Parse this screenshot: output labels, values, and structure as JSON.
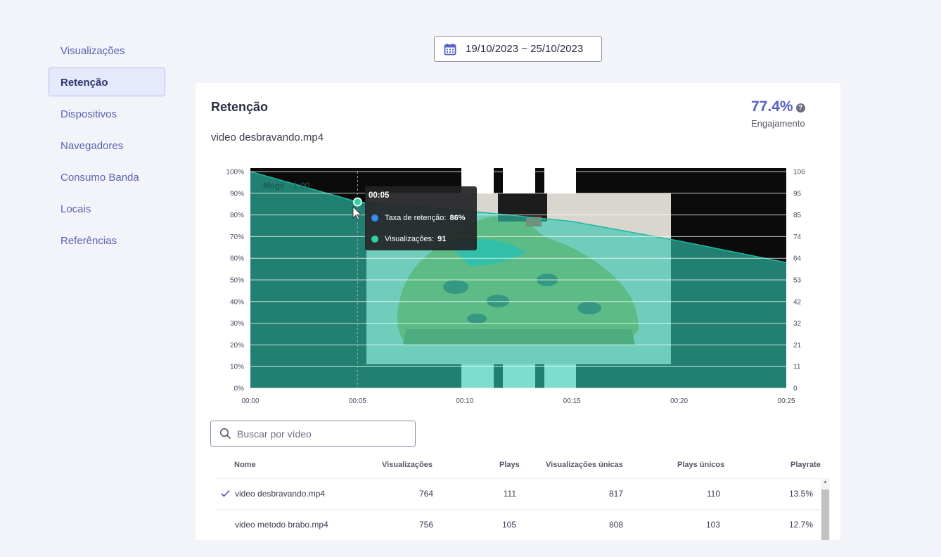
{
  "sidebar": {
    "items": [
      {
        "label": "Visualizações"
      },
      {
        "label": "Retenção"
      },
      {
        "label": "Dispositivos"
      },
      {
        "label": "Navegadores"
      },
      {
        "label": "Consumo Banda"
      },
      {
        "label": "Locais"
      },
      {
        "label": "Referências"
      }
    ],
    "active_index": 1
  },
  "date_range": "19/10/2023 ~ 25/10/2023",
  "card": {
    "title": "Retenção",
    "video_name": "video desbravando.mp4",
    "engagement_value": "77.4%",
    "engagement_label": "Engajamento",
    "help_symbol": "?"
  },
  "video_overlay": {
    "watermark": "Mege",
    "speed": "1.00"
  },
  "tooltip": {
    "time": "00:05",
    "retention_label": "Taxa de retenção:",
    "retention_value": "86%",
    "views_label": "Visualizações:",
    "views_value": "91",
    "retention_color": "#2f8ff0",
    "views_color": "#2ed69a"
  },
  "chart_data": {
    "type": "area",
    "x": [
      "00:00",
      "00:05",
      "00:10",
      "00:15",
      "00:20",
      "00:25"
    ],
    "x_seconds": [
      0,
      5,
      10,
      15,
      20,
      25
    ],
    "series": [
      {
        "values_seconds": [
          0,
          5,
          10,
          15,
          20,
          25
        ],
        "retention_pct": [
          100,
          86,
          82,
          77,
          68,
          58
        ]
      }
    ],
    "y_left_ticks": [
      "100%",
      "90%",
      "80%",
      "70%",
      "60%",
      "50%",
      "40%",
      "30%",
      "20%",
      "10%",
      "0%"
    ],
    "y_right_ticks": [
      "106",
      "95",
      "85",
      "74",
      "64",
      "53",
      "42",
      "32",
      "21",
      "11",
      "0"
    ],
    "ylim_left": [
      0,
      100
    ],
    "ylim_right": [
      0,
      106
    ],
    "grid": true,
    "fill_color": "#2ec8b0",
    "line_color": "#1fb89f"
  },
  "search": {
    "placeholder": "Buscar por vídeo"
  },
  "table": {
    "headers": [
      "Nome",
      "Visualizações",
      "Plays",
      "Visualizações únicas",
      "Plays únicos",
      "Playrate"
    ],
    "rows": [
      {
        "selected": true,
        "name": "video desbravando.mp4",
        "views": "764",
        "plays": "111",
        "unique_views": "817",
        "unique_plays": "110",
        "playrate": "13.5%"
      },
      {
        "selected": false,
        "name": "video metodo brabo.mp4",
        "views": "756",
        "plays": "105",
        "unique_views": "808",
        "unique_plays": "103",
        "playrate": "12.7%"
      }
    ]
  },
  "colors": {
    "accent": "#5660c7",
    "nav_text": "#5b62b4",
    "active_bg": "#e6e9fb"
  }
}
